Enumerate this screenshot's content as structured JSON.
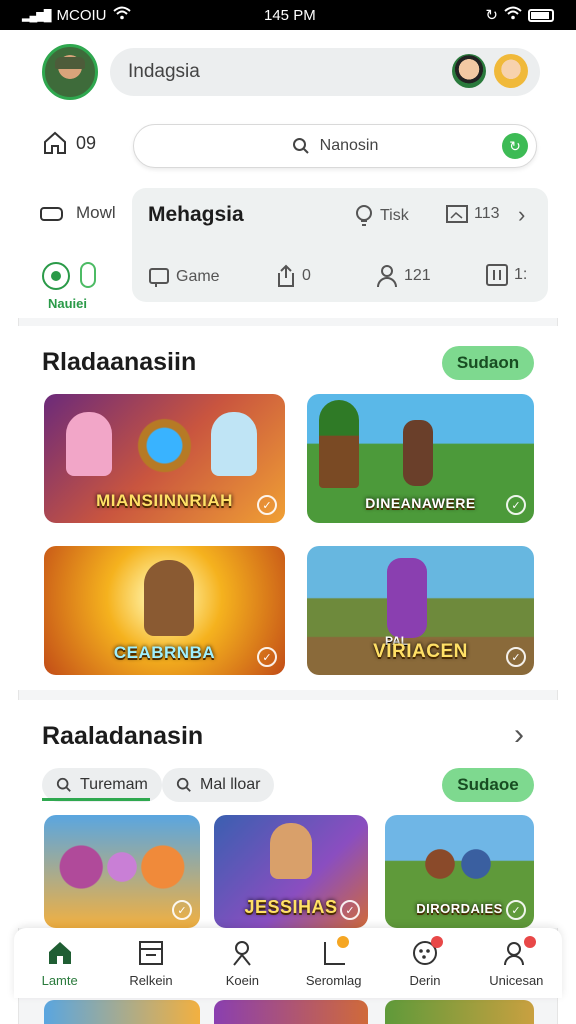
{
  "status_bar": {
    "carrier": "MCOIU",
    "time": "145 PM"
  },
  "header": {
    "search_text": "Indagsia"
  },
  "row2": {
    "home_count": "09",
    "search_placeholder": "Nanosin"
  },
  "sidebar": {
    "mowl_label": "Mowl",
    "active_label": "Nauiei"
  },
  "panel": {
    "title": "Mehagsia",
    "tisk_label": "Tisk",
    "count_113": "113",
    "game_label": "Game",
    "share_count": "0",
    "user_count": "121",
    "pause_count": "1:"
  },
  "section1": {
    "title": "Rladaanasiin",
    "button_label": "Sudaon",
    "cards": [
      {
        "label": "MIANSIINNRIAH"
      },
      {
        "label": "DINEANAWERE"
      },
      {
        "label": "CEABRNBA"
      },
      {
        "label": "VIRIACEN",
        "badge": "PAL"
      }
    ]
  },
  "section2": {
    "title": "Raaladanasin",
    "button_label": "Sudaoe",
    "chips": [
      "Turemam",
      "Mal lloar"
    ],
    "cards": [
      {
        "label": ""
      },
      {
        "label": "JESSIHAS"
      },
      {
        "label": "DIRORDAIES"
      }
    ]
  },
  "bottom_nav": {
    "items": [
      {
        "label": "Lamte",
        "icon": "home-icon"
      },
      {
        "label": "Relkein",
        "icon": "calendar-icon"
      },
      {
        "label": "Koein",
        "icon": "person-icon"
      },
      {
        "label": "Seromlag",
        "icon": "chart-icon"
      },
      {
        "label": "Derin",
        "icon": "gamepad-icon"
      },
      {
        "label": "Unicesan",
        "icon": "user-icon"
      }
    ]
  },
  "colors": {
    "accent_green": "#2fa84f",
    "button_green": "#7ed98f",
    "badge_orange": "#f5a623",
    "badge_red": "#e84848"
  }
}
